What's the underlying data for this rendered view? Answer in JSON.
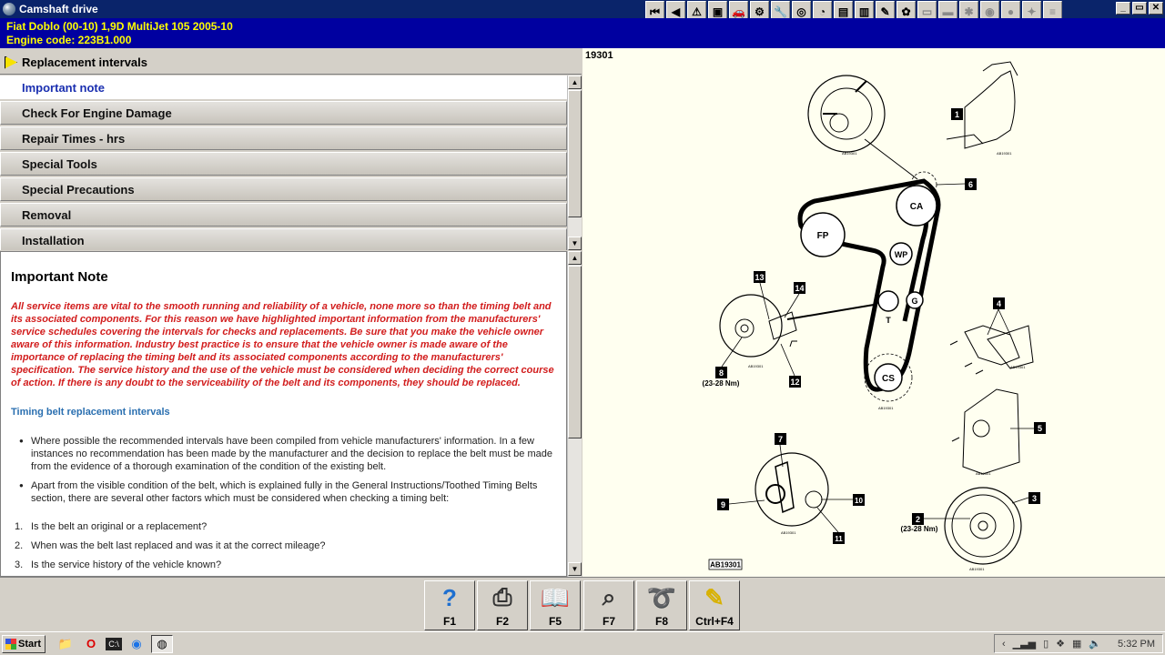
{
  "window": {
    "title": "Camshaft drive",
    "controls": {
      "minimize": "_",
      "restore": "▭",
      "close": "✕"
    }
  },
  "vehicle": {
    "line1": "Fiat   Doblo (00-10) 1,9D MultiJet 105 2005-10",
    "line2": "Engine code: 223B1.000"
  },
  "toolbar_icons": [
    {
      "name": "first-icon",
      "glyph": "⏮"
    },
    {
      "name": "back-icon",
      "glyph": "◀"
    },
    {
      "name": "warning-icon",
      "glyph": "⚠"
    },
    {
      "name": "notes-icon",
      "glyph": "▣"
    },
    {
      "name": "car-icon",
      "glyph": "🚗"
    },
    {
      "name": "service-icon",
      "glyph": "⚙"
    },
    {
      "name": "tools-icon",
      "glyph": "🔧"
    },
    {
      "name": "wheel-icon",
      "glyph": "◎"
    },
    {
      "name": "gauge-icon",
      "glyph": "◔"
    },
    {
      "name": "engine-icon",
      "glyph": "▤"
    },
    {
      "name": "fuel-icon",
      "glyph": "▥"
    },
    {
      "name": "spanner-icon",
      "glyph": "✎"
    },
    {
      "name": "frog-icon",
      "glyph": "✿"
    },
    {
      "name": "doc-icon",
      "glyph": "▭"
    },
    {
      "name": "car2-icon",
      "glyph": "▬"
    },
    {
      "name": "fan-icon",
      "glyph": "✱"
    },
    {
      "name": "brake-icon",
      "glyph": "◉"
    },
    {
      "name": "tyre-icon",
      "glyph": "●"
    },
    {
      "name": "light-icon",
      "glyph": "✦"
    },
    {
      "name": "clip-icon",
      "glyph": "≡"
    }
  ],
  "section": {
    "title": "Replacement intervals"
  },
  "menu": [
    {
      "label": "Important note",
      "active": true
    },
    {
      "label": "Check For Engine Damage",
      "active": false
    },
    {
      "label": "Repair Times - hrs",
      "active": false
    },
    {
      "label": "Special Tools",
      "active": false
    },
    {
      "label": "Special Precautions",
      "active": false
    },
    {
      "label": "Removal",
      "active": false
    },
    {
      "label": "Installation",
      "active": false
    }
  ],
  "note": {
    "heading": "Important Note",
    "warning": "All service items are vital to the smooth running and reliability of a vehicle, none more so than the timing belt and its associated components. For this reason we have highlighted important information from the manufacturers' service schedules covering the intervals for checks and replacements. Be sure that you make the vehicle owner aware of this information. Industry best practice is to ensure that the vehicle owner is made aware of the importance of replacing the timing belt and its associated components according to the manufacturers' specification. The service history and the use of the vehicle must be considered when deciding the correct course of action. If there is any doubt to the serviceability of the belt and its components, they should be replaced.",
    "subheading": "Timing belt replacement intervals",
    "bullets": [
      "Where possible the recommended intervals have been compiled from vehicle manufacturers' information. In a few instances no recommendation has been made by the manufacturer and the decision to replace the belt must be made from the evidence of a thorough examination of the condition of the existing belt.",
      "Apart from the visible condition of the belt, which is explained fully in the General Instructions/Toothed Timing Belts section, there are several other factors which must be considered when checking a timing belt:"
    ],
    "questions": [
      {
        "num": "1.",
        "text": "Is the belt an original or a replacement?"
      },
      {
        "num": "2.",
        "text": "When was the belt last replaced and was it at the correct mileage?"
      },
      {
        "num": "3.",
        "text": "Is the service history of the vehicle known?"
      }
    ]
  },
  "diagram": {
    "id": "19301",
    "ref": "AB19301",
    "small_ref": "AB19301",
    "pulleys": {
      "fp": "FP",
      "ca": "CA",
      "wp": "WP",
      "t": "T",
      "g": "G",
      "cs": "CS"
    },
    "callouts": [
      "1",
      "2",
      "3",
      "4",
      "5",
      "6",
      "7",
      "8",
      "9",
      "10",
      "11",
      "12",
      "13",
      "14"
    ],
    "torque_8": "(23-28 Nm)",
    "torque_2": "(23-28 Nm)"
  },
  "fkeys": [
    {
      "label": "F1",
      "name": "help-icon",
      "glyph": "?",
      "color": "#1e6fd0"
    },
    {
      "label": "F2",
      "name": "print-icon",
      "glyph": "⎙",
      "color": "#333333"
    },
    {
      "label": "F5",
      "name": "book-icon",
      "glyph": "📖",
      "color": "#333333"
    },
    {
      "label": "F7",
      "name": "zoom-icon",
      "glyph": "⌕",
      "color": "#333333"
    },
    {
      "label": "F8",
      "name": "belt-icon",
      "glyph": "➰",
      "color": "#333333"
    },
    {
      "label": "Ctrl+F4",
      "name": "notes-edit-icon",
      "glyph": "✎",
      "color": "#d8b100"
    }
  ],
  "taskbar": {
    "start": "Start",
    "clock": "5:32 PM"
  }
}
